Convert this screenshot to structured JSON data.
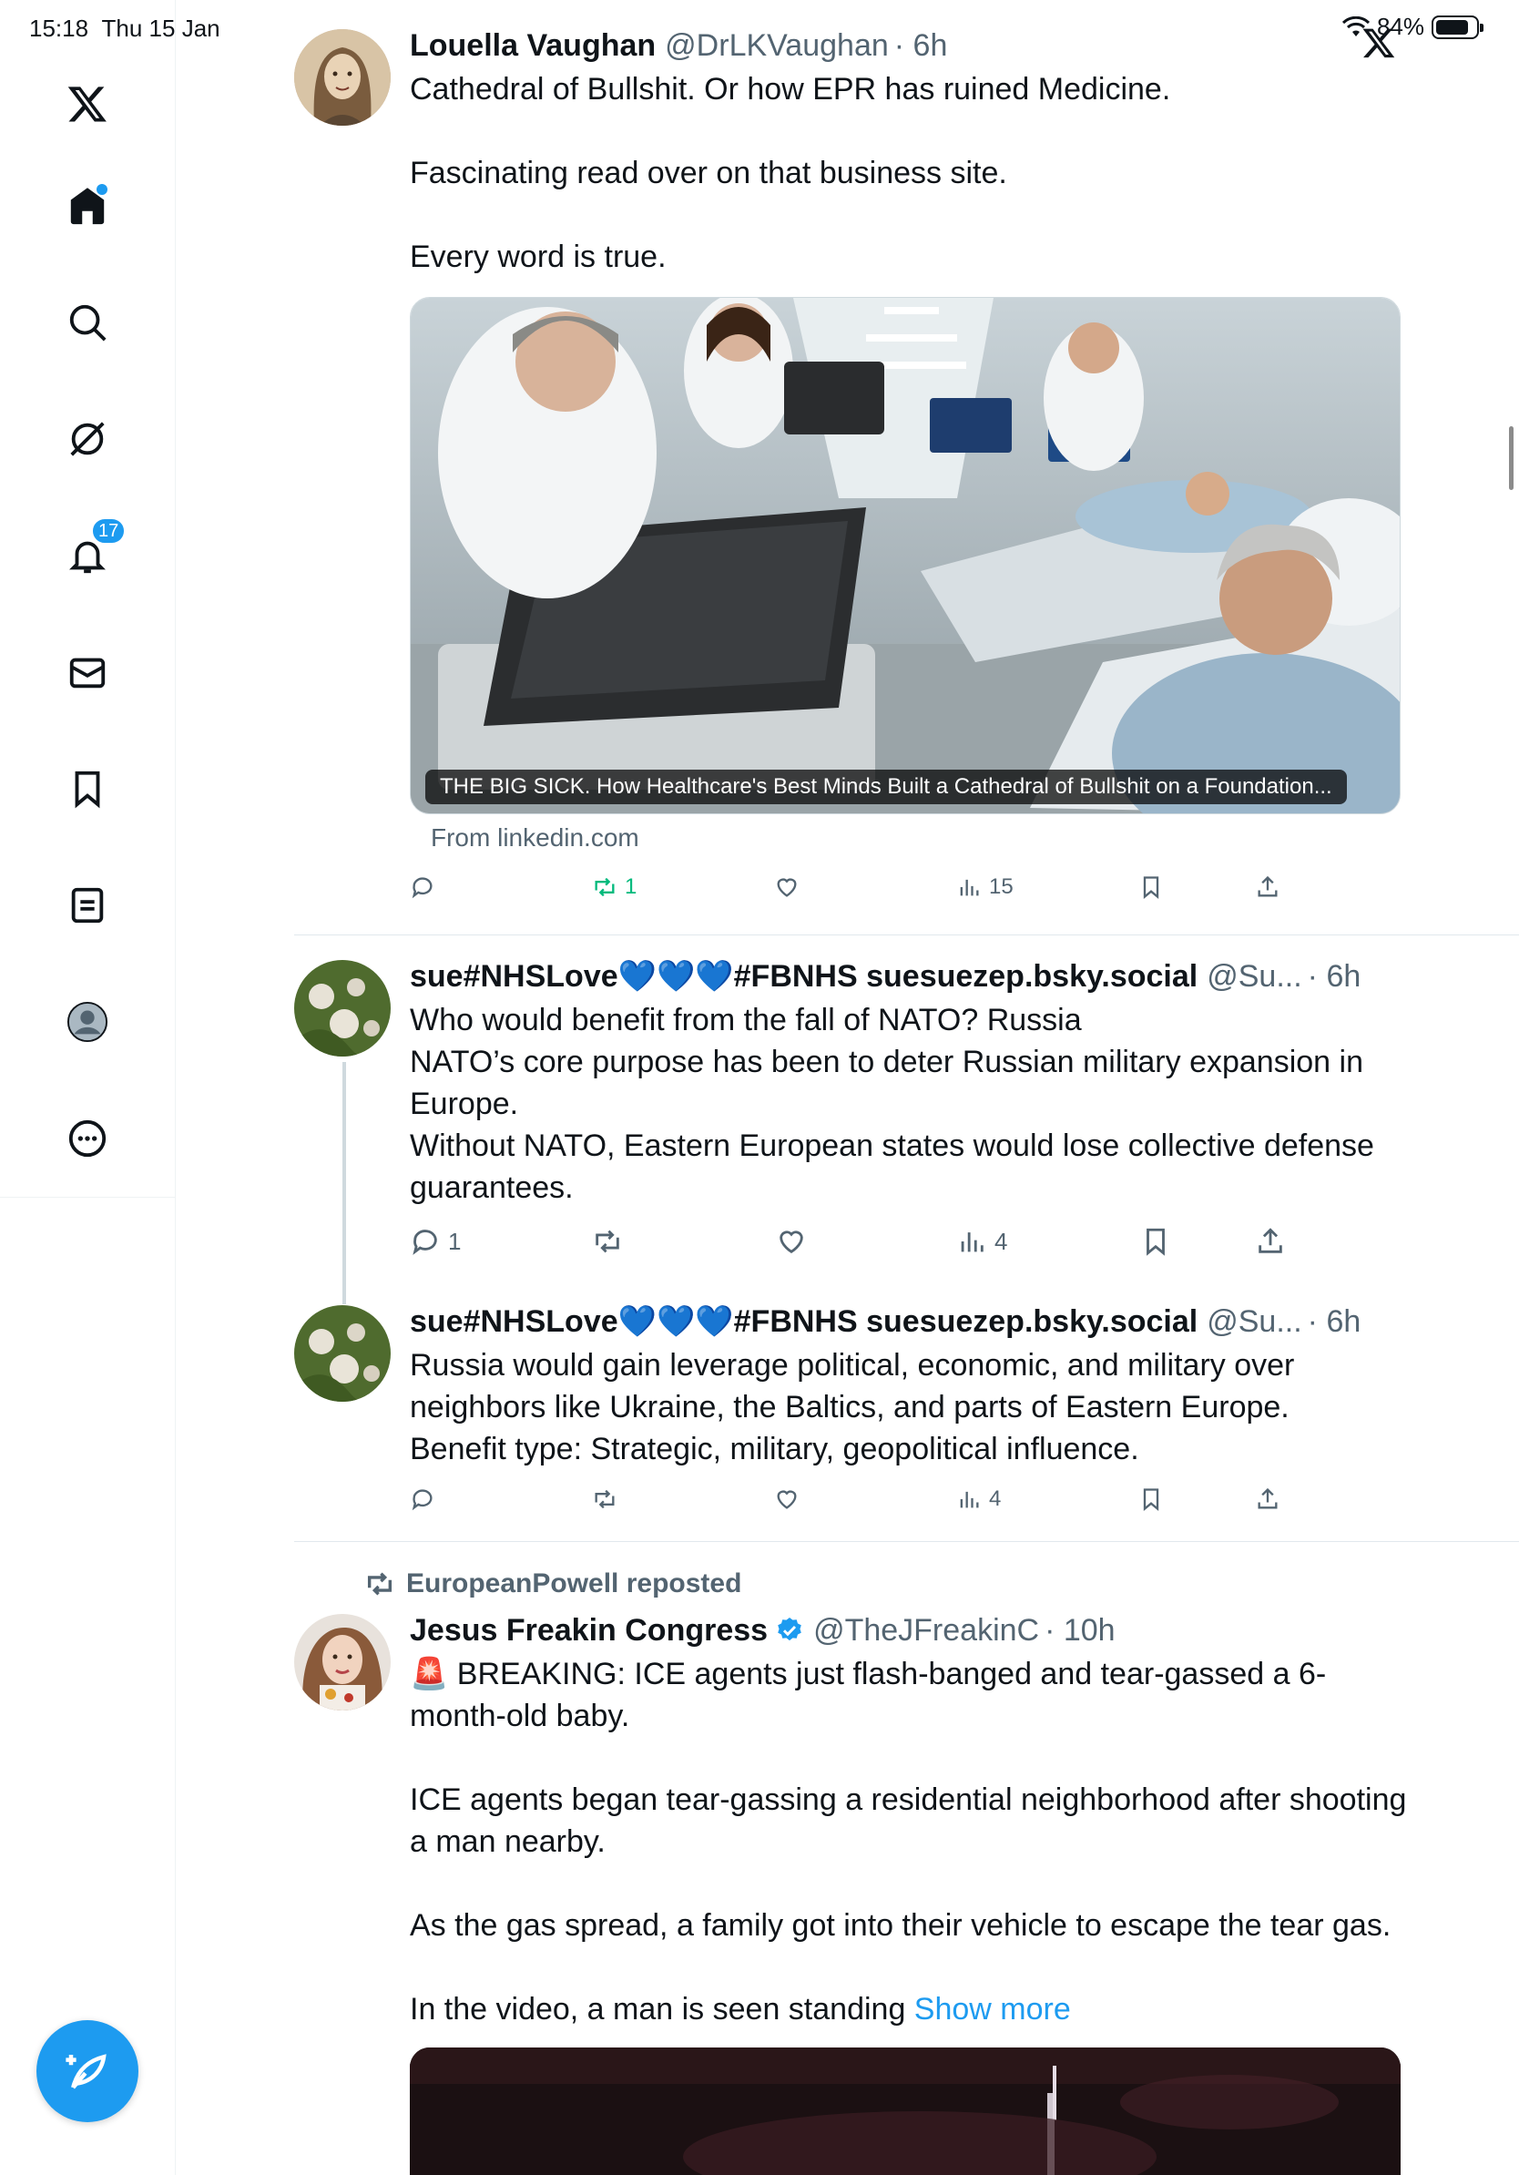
{
  "status_bar": {
    "time": "15:18",
    "date": "Thu 15 Jan",
    "battery": "84%",
    "battery_level": 0.84
  },
  "sidebar": {
    "notifications_badge": "17",
    "items": [
      "X logo",
      "Home",
      "Search",
      "Grok",
      "Notifications",
      "Messages",
      "Bookmarks",
      "Lists",
      "Profile",
      "More"
    ]
  },
  "tweets": [
    {
      "name": "Louella Vaughan",
      "handle": "@DrLKVaughan",
      "time": "· 6h",
      "text": "Cathedral of Bullshit. Or how EPR has ruined Medicine.\n\nFascinating read over on that business site.\n\nEvery word is true.",
      "card_caption": "THE BIG SICK. How Healthcare's Best Minds Built a Cathedral of Bullshit on a Foundation...",
      "card_source": "From linkedin.com",
      "replies": "",
      "reposts": "1",
      "likes": "",
      "views": "15"
    },
    {
      "name": "sue#NHSLove💙💙💙#FBNHS suesuezep.bsky.social",
      "handle": "@Su...",
      "time": "· 6h",
      "text": "Who would benefit from the fall of NATO? Russia\nNATO’s core purpose has been to deter Russian military expansion in Europe.\nWithout NATO, Eastern European states would lose collective defense guarantees.",
      "replies": "1",
      "reposts": "",
      "likes": "",
      "views": "4"
    },
    {
      "name": "sue#NHSLove💙💙💙#FBNHS suesuezep.bsky.social",
      "handle": "@Su...",
      "time": "· 6h",
      "text": "Russia would gain leverage political, economic, and military over neighbors like Ukraine, the Baltics, and parts of Eastern Europe.\nBenefit type: Strategic, military, geopolitical influence.",
      "more": "···",
      "replies": "",
      "reposts": "",
      "likes": "",
      "views": "4"
    },
    {
      "reposted_by": "EuropeanPowell reposted",
      "name": "Jesus Freakin Congress",
      "handle": "@TheJFreakinC",
      "time": "· 10h",
      "text": "🚨 BREAKING: ICE agents just flash-banged and tear-gassed a 6-month-old baby.\n\nICE agents began tear-gassing a residential neighborhood after shooting a man nearby.\n\nAs the gas spread, a family got into their vehicle to escape the tear gas.\n\nIn the video, a man is seen standing ",
      "show_more": "Show more"
    }
  ]
}
